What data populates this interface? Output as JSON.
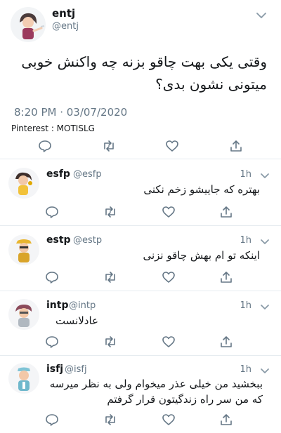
{
  "main_tweet": {
    "display_name": "entj",
    "handle": "@entj",
    "text_line1": "وقتی یکی بهت چاقو بزنه چه واکنش خوبی",
    "text_line2": "میتونی نشون بدی؟",
    "timestamp": "8:20 PM · 03/07/2020",
    "credit": "Pinterest : MOTISLG",
    "avatar_icon": "entj-cartoon-avatar-icon"
  },
  "replies": [
    {
      "display_name": "esfp",
      "handle": "@esfp",
      "time": "1h",
      "text": "بهتره که جاییشو زخم نکنی",
      "avatar_icon": "esfp-cartoon-avatar-icon"
    },
    {
      "display_name": "estp",
      "handle": "@estp",
      "time": "1h",
      "text": "اینکه تو ام بهش چاقو نزنی",
      "avatar_icon": "estp-cartoon-avatar-icon"
    },
    {
      "display_name": "intp",
      "handle": "@intp",
      "time": "1h",
      "text": "عادلانست",
      "avatar_icon": "intp-cartoon-avatar-icon"
    },
    {
      "display_name": "isfj",
      "handle": "@isfj",
      "time": "1h",
      "text_line1": "ببخشید من خیلی عذر میخوام ولی به نظر میرسه",
      "text_line2": "که من سر راه زندگیتون قرار گرفتم",
      "avatar_icon": "isfj-cartoon-avatar-icon"
    }
  ],
  "colors": {
    "text": "#14171a",
    "secondary": "#657786",
    "accent": "#1da1f2",
    "divider": "#e6ecf0"
  }
}
